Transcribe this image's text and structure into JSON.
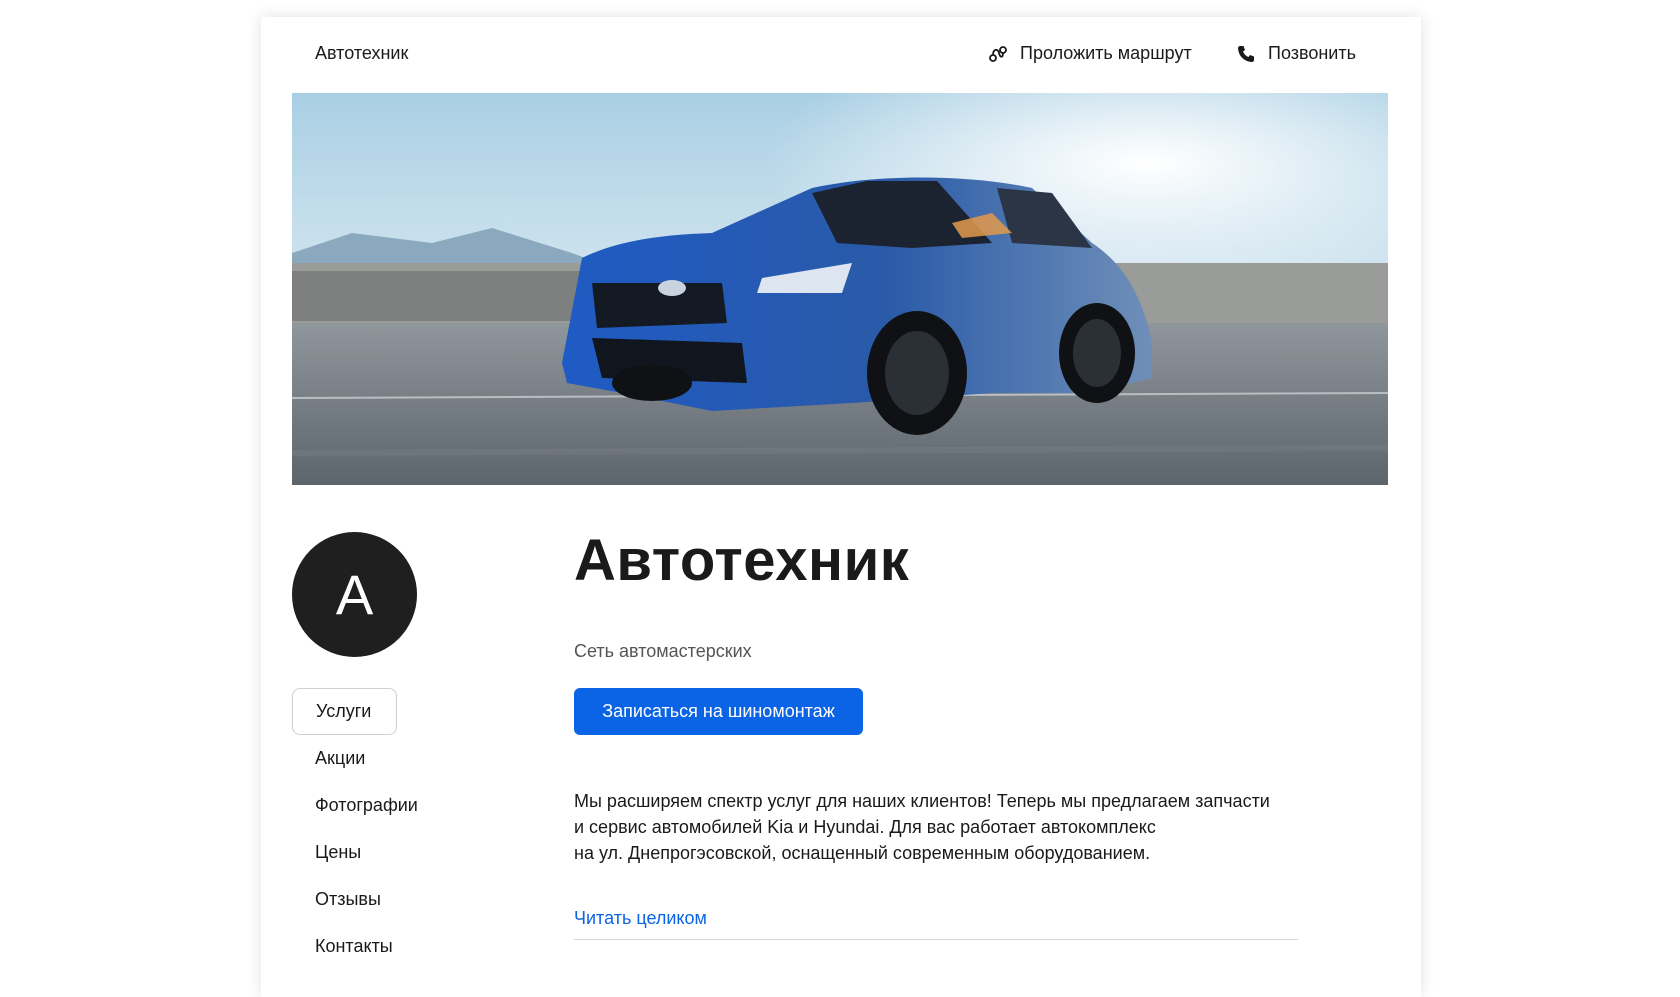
{
  "header": {
    "brand": "Автотехник",
    "route_label": "Проложить маршрут",
    "call_label": "Позвонить",
    "route_icon": "route-icon",
    "call_icon": "phone-icon"
  },
  "hero": {
    "image": "blue-sports-car-on-highway"
  },
  "profile": {
    "avatar_letter": "А",
    "title": "Автотехник",
    "subtitle": "Сеть автомастерских",
    "cta_label": "Записаться на шиномонтаж",
    "description": [
      "Мы расширяем спектр услуг для наших клиентов! Теперь мы предлагаем запчасти",
      "и сервис автомобилей Kia и Hyundai. Для вас работает автокомплекс",
      "на ул. Днепрогэсовской, оснащенный современным оборудованием."
    ],
    "read_more": "Читать целиком"
  },
  "sidenav": {
    "items": [
      {
        "label": "Услуги",
        "active": true
      },
      {
        "label": "Акции",
        "active": false
      },
      {
        "label": "Фотографии",
        "active": false
      },
      {
        "label": "Цены",
        "active": false
      },
      {
        "label": "Отзывы",
        "active": false
      },
      {
        "label": "Контакты",
        "active": false
      }
    ]
  },
  "colors": {
    "accent": "#0b63e5",
    "avatar_bg": "#1f1f1f",
    "text": "#1a1a1a"
  }
}
